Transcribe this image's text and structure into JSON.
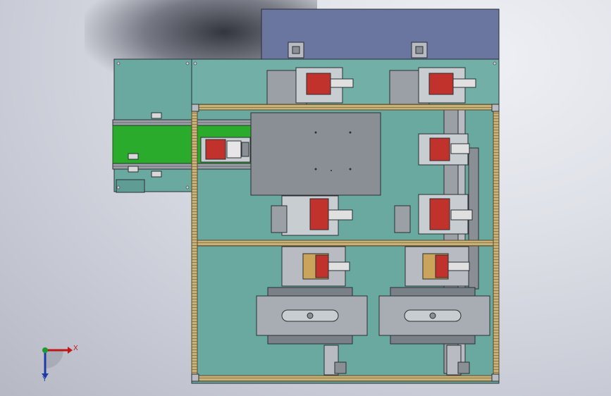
{
  "viewport": {
    "view": "top",
    "background": "#d4d7df"
  },
  "colors": {
    "frame_fill": "#6aa9a0",
    "frame_dark": "#4e8a82",
    "top_panel": "#6b76a0",
    "aluminum": "#c8b27a",
    "aluminum_dark": "#8c7a4a",
    "conveyor_green": "#2bab2b",
    "part_red": "#c2322c",
    "plate_gray": "#8a8f96",
    "steel": "#b8bcc2",
    "edge": "#2a2f33"
  },
  "triad": {
    "x_label": "X",
    "y_label": "Y",
    "x_color": "#c01818",
    "y_color": "#1d3aa8",
    "z_color": "#1c9c30"
  }
}
